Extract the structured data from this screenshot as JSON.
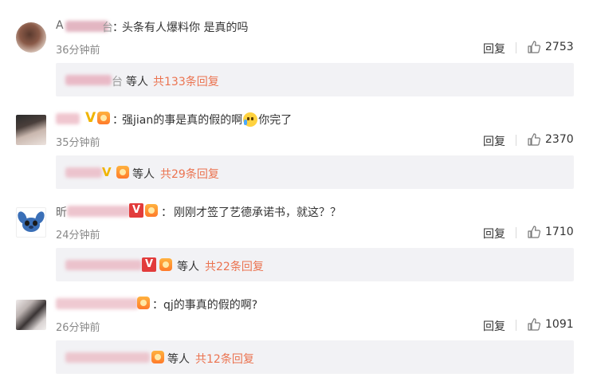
{
  "colors": {
    "text": "#333333",
    "muted": "#888888",
    "accent": "#eb7350",
    "sub_bg": "#f2f2f5"
  },
  "comments": [
    {
      "name_visible": "A",
      "name_visible_end": "台",
      "colon": "：",
      "text": "头条有人爆料你 是真的吗",
      "time": "36分钟前",
      "reply_label": "回复",
      "likes": "2753",
      "sub": {
        "name_visible_end": "台",
        "dengren": "等人",
        "reply_count": "共133条回复"
      }
    },
    {
      "colon": "：",
      "text_part1": "强jian的事是真的假的啊",
      "text_part2": "你完了",
      "time": "35分钟前",
      "reply_label": "回复",
      "likes": "2370",
      "sub": {
        "dengren": "等人",
        "reply_count": "共29条回复"
      }
    },
    {
      "name_visible": "昕",
      "colon": "：",
      "text": "刚刚才签了艺德承诺书，就这？？",
      "time": "24分钟前",
      "reply_label": "回复",
      "likes": "1710",
      "sub": {
        "dengren": "等人",
        "reply_count": "共22条回复"
      }
    },
    {
      "colon": "：",
      "text": "qj的事真的假的啊?",
      "time": "26分钟前",
      "reply_label": "回复",
      "likes": "1091",
      "sub": {
        "dengren": "等人",
        "reply_count": "共12条回复"
      }
    }
  ]
}
